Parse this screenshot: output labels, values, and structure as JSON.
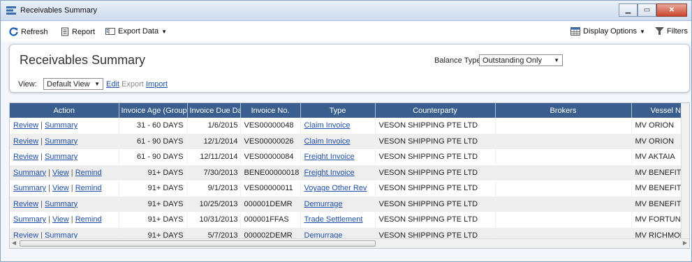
{
  "window": {
    "title": "Receivables Summary"
  },
  "toolbar": {
    "refresh": "Refresh",
    "report": "Report",
    "export_data": "Export Data",
    "display_options": "Display Options",
    "filters": "Filters"
  },
  "panel": {
    "title": "Receivables Summary",
    "balance_type_label": "Balance Type:",
    "balance_type_value": "Outstanding Only",
    "view_label": "View:",
    "view_value": "Default View",
    "edit": "Edit",
    "export": "Export",
    "import": "Import"
  },
  "grid": {
    "columns": [
      "Action",
      "Invoice Age (Group)",
      "Invoice Due Date",
      "Invoice No.",
      "Type",
      "Counterparty",
      "Brokers",
      "Vessel Name"
    ],
    "rows": [
      {
        "actions": [
          "Review",
          "Summary"
        ],
        "age": "31 - 60 DAYS",
        "due": "1/6/2015",
        "invoice": "VES00000048",
        "type": "Claim Invoice",
        "counterparty": "VESON SHIPPING PTE LTD",
        "brokers": "",
        "vessel": "MV ORION"
      },
      {
        "actions": [
          "Review",
          "Summary"
        ],
        "age": "61 - 90 DAYS",
        "due": "12/1/2014",
        "invoice": "VES00000026",
        "type": "Claim Invoice",
        "counterparty": "VESON SHIPPING PTE LTD",
        "brokers": "",
        "vessel": "MV ORION"
      },
      {
        "actions": [
          "Review",
          "Summary"
        ],
        "age": "61 - 90 DAYS",
        "due": "12/11/2014",
        "invoice": "VES00000084",
        "type": "Freight Invoice",
        "counterparty": "VESON SHIPPING PTE LTD",
        "brokers": "",
        "vessel": "MV AKTAIA"
      },
      {
        "actions": [
          "Summary",
          "View",
          "Remind"
        ],
        "age": "91+ DAYS",
        "due": "7/30/2013",
        "invoice": "BENE00000018",
        "type": "Freight Invoice",
        "counterparty": "VESON SHIPPING PTE LTD",
        "brokers": "",
        "vessel": "MV BENEFIT"
      },
      {
        "actions": [
          "Summary",
          "View",
          "Remind"
        ],
        "age": "91+ DAYS",
        "due": "9/1/2013",
        "invoice": "VES00000011",
        "type": "Voyage Other Rev",
        "counterparty": "VESON SHIPPING PTE LTD",
        "brokers": "",
        "vessel": "MV BENEFIT"
      },
      {
        "actions": [
          "Review",
          "Summary"
        ],
        "age": "91+ DAYS",
        "due": "10/25/2013",
        "invoice": "000001DEMR",
        "type": "Demurrage",
        "counterparty": "VESON SHIPPING PTE LTD",
        "brokers": "",
        "vessel": "MV BENEFIT"
      },
      {
        "actions": [
          "Summary",
          "View",
          "Remind"
        ],
        "age": "91+ DAYS",
        "due": "10/31/2013",
        "invoice": "000001FFAS",
        "type": "Trade Settlement",
        "counterparty": "VESON SHIPPING PTE LTD",
        "brokers": "",
        "vessel": "MV FORTUNA"
      },
      {
        "actions": [
          "Review",
          "Summary"
        ],
        "age": "91+ DAYS",
        "due": "5/7/2013",
        "invoice": "000002DEMR",
        "type": "Demurrage",
        "counterparty": "VESON SHIPPING PTE LTD",
        "brokers": "",
        "vessel": "MV RICHMOND"
      }
    ]
  },
  "colors": {
    "header_bg": "#3a5f8f",
    "link": "#1f4fa8",
    "alt_row": "#eeeeee"
  }
}
